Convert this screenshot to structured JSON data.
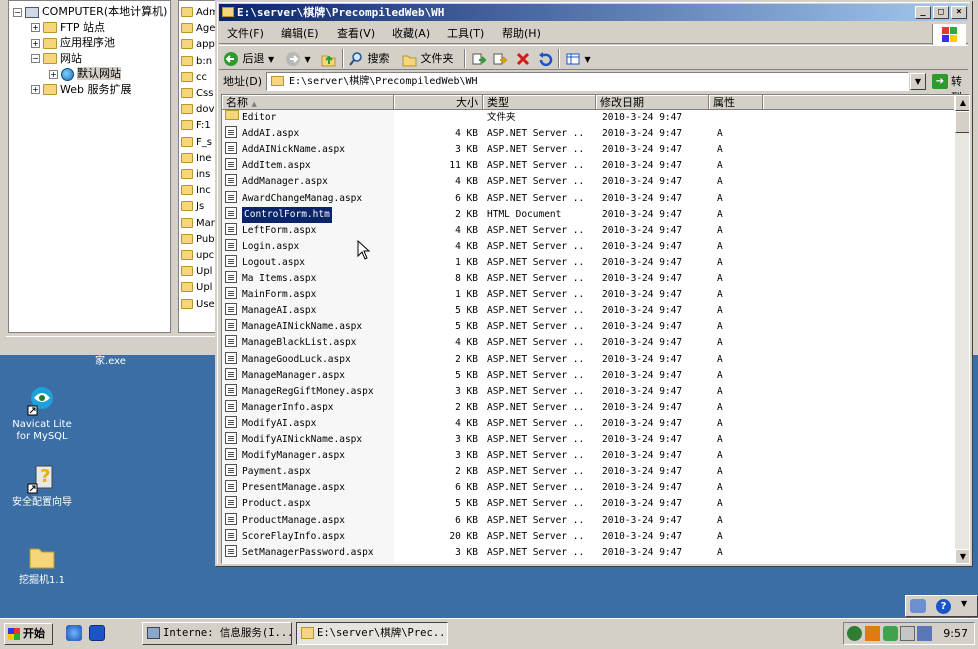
{
  "iis_tree": [
    {
      "label": "COMPUTER(本地计算机)",
      "icon": "computer-icon",
      "expander": "−"
    },
    {
      "label": "FTP 站点",
      "icon": "folder-icon",
      "expander": "+"
    },
    {
      "label": "应用程序池",
      "icon": "folder-icon",
      "expander": "+"
    },
    {
      "label": "网站",
      "icon": "folder-icon",
      "expander": "−"
    },
    {
      "label": "默认网站",
      "icon": "globe-icon",
      "expander": "+"
    },
    {
      "label": "Web 服务扩展",
      "icon": "folder-icon",
      "expander": "+"
    }
  ],
  "iis_list": [
    "Adm",
    "Age",
    "app",
    "b:n",
    "cc",
    "Css",
    "dov",
    "F:1",
    "F_s",
    "Ine",
    "ins",
    "Inc",
    "Js",
    "Mar",
    "Pub",
    "upc",
    "Upl",
    "Upl",
    "Use"
  ],
  "desktop": {
    "caption_top": "家.exe",
    "icons": [
      {
        "label1": "Navicat Lite",
        "label2": "for MySQL",
        "icon": "navicat-icon"
      },
      {
        "label1": "安全配置向导",
        "label2": "",
        "icon": "security-wizard-icon"
      },
      {
        "label1": "挖掘机1.1",
        "label2": "",
        "icon": "folder-icon"
      }
    ]
  },
  "window": {
    "title": "E:\\server\\棋牌\\PrecompiledWeb\\WH",
    "controls": {
      "minimize": "_",
      "maximize": "□",
      "close": "×"
    },
    "menu": [
      "文件(F)",
      "编辑(E)",
      "查看(V)",
      "收藏(A)",
      "工具(T)",
      "帮助(H)"
    ],
    "toolbar": {
      "back": "后退",
      "search": "搜索",
      "folders": "文件夹"
    },
    "address": {
      "label": "地址(D)",
      "value": "E:\\server\\棋牌\\PrecompiledWeb\\WH",
      "go": "转到"
    },
    "columns": {
      "name": "名称",
      "size": "大小",
      "type": "类型",
      "date": "修改日期",
      "attr": "属性"
    },
    "files": [
      {
        "name": "Editor",
        "size": "",
        "type": "文件夹",
        "date": "2010-3-24 9:47",
        "attr": "",
        "kind": "folder"
      },
      {
        "name": "AddAI.aspx",
        "size": "4 KB",
        "type": "ASP.NET Server ..",
        "date": "2010-3-24 9:47",
        "attr": "A",
        "kind": "file"
      },
      {
        "name": "AddAINickName.aspx",
        "size": "3 KB",
        "type": "ASP.NET Server ..",
        "date": "2010-3-24 9:47",
        "attr": "A",
        "kind": "file"
      },
      {
        "name": "AddItem.aspx",
        "size": "11 KB",
        "type": "ASP.NET Server ..",
        "date": "2010-3-24 9:47",
        "attr": "A",
        "kind": "file"
      },
      {
        "name": "AddManager.aspx",
        "size": "4 KB",
        "type": "ASP.NET Server ..",
        "date": "2010-3-24 9:47",
        "attr": "A",
        "kind": "file"
      },
      {
        "name": "AwardChangeManag.aspx",
        "size": "6 KB",
        "type": "ASP.NET Server ..",
        "date": "2010-3-24 9:47",
        "attr": "A",
        "kind": "file"
      },
      {
        "name": "ControlForm.htm",
        "size": "2 KB",
        "type": "HTML Document",
        "date": "2010-3-24 9:47",
        "attr": "A",
        "kind": "html",
        "selected": true
      },
      {
        "name": "LeftForm.aspx",
        "size": "4 KB",
        "type": "ASP.NET Server ..",
        "date": "2010-3-24 9:47",
        "attr": "A",
        "kind": "file"
      },
      {
        "name": "Login.aspx",
        "size": "4 KB",
        "type": "ASP.NET Server ..",
        "date": "2010-3-24 9:47",
        "attr": "A",
        "kind": "file"
      },
      {
        "name": "Logout.aspx",
        "size": "1 KB",
        "type": "ASP.NET Server ..",
        "date": "2010-3-24 9:47",
        "attr": "A",
        "kind": "file"
      },
      {
        "name": "Ma Items.aspx",
        "size": "8 KB",
        "type": "ASP.NET Server ..",
        "date": "2010-3-24 9:47",
        "attr": "A",
        "kind": "file"
      },
      {
        "name": "MainForm.aspx",
        "size": "1 KB",
        "type": "ASP.NET Server ..",
        "date": "2010-3-24 9:47",
        "attr": "A",
        "kind": "file"
      },
      {
        "name": "ManageAI.aspx",
        "size": "5 KB",
        "type": "ASP.NET Server ..",
        "date": "2010-3-24 9:47",
        "attr": "A",
        "kind": "file"
      },
      {
        "name": "ManageAINickName.aspx",
        "size": "5 KB",
        "type": "ASP.NET Server ..",
        "date": "2010-3-24 9:47",
        "attr": "A",
        "kind": "file"
      },
      {
        "name": "ManageBlackList.aspx",
        "size": "4 KB",
        "type": "ASP.NET Server ..",
        "date": "2010-3-24 9:47",
        "attr": "A",
        "kind": "file"
      },
      {
        "name": "ManageGoodLuck.aspx",
        "size": "2 KB",
        "type": "ASP.NET Server ..",
        "date": "2010-3-24 9:47",
        "attr": "A",
        "kind": "file"
      },
      {
        "name": "ManageManager.aspx",
        "size": "5 KB",
        "type": "ASP.NET Server ..",
        "date": "2010-3-24 9:47",
        "attr": "A",
        "kind": "file"
      },
      {
        "name": "ManageRegGiftMoney.aspx",
        "size": "3 KB",
        "type": "ASP.NET Server ..",
        "date": "2010-3-24 9:47",
        "attr": "A",
        "kind": "file"
      },
      {
        "name": "ManagerInfo.aspx",
        "size": "2 KB",
        "type": "ASP.NET Server ..",
        "date": "2010-3-24 9:47",
        "attr": "A",
        "kind": "file"
      },
      {
        "name": "ModifyAI.aspx",
        "size": "4 KB",
        "type": "ASP.NET Server ..",
        "date": "2010-3-24 9:47",
        "attr": "A",
        "kind": "file"
      },
      {
        "name": "ModifyAINickName.aspx",
        "size": "3 KB",
        "type": "ASP.NET Server ..",
        "date": "2010-3-24 9:47",
        "attr": "A",
        "kind": "file"
      },
      {
        "name": "ModifyManager.aspx",
        "size": "3 KB",
        "type": "ASP.NET Server ..",
        "date": "2010-3-24 9:47",
        "attr": "A",
        "kind": "file"
      },
      {
        "name": "Payment.aspx",
        "size": "2 KB",
        "type": "ASP.NET Server ..",
        "date": "2010-3-24 9:47",
        "attr": "A",
        "kind": "file"
      },
      {
        "name": "PresentManage.aspx",
        "size": "6 KB",
        "type": "ASP.NET Server ..",
        "date": "2010-3-24 9:47",
        "attr": "A",
        "kind": "file"
      },
      {
        "name": "Product.aspx",
        "size": "5 KB",
        "type": "ASP.NET Server ..",
        "date": "2010-3-24 9:47",
        "attr": "A",
        "kind": "file"
      },
      {
        "name": "ProductManage.aspx",
        "size": "6 KB",
        "type": "ASP.NET Server ..",
        "date": "2010-3-24 9:47",
        "attr": "A",
        "kind": "file"
      },
      {
        "name": "ScoreFlayInfo.aspx",
        "size": "20 KB",
        "type": "ASP.NET Server ..",
        "date": "2010-3-24 9:47",
        "attr": "A",
        "kind": "file"
      },
      {
        "name": "SetManagerPassword.aspx",
        "size": "3 KB",
        "type": "ASP.NET Server ..",
        "date": "2010-3-24 9:47",
        "attr": "A",
        "kind": "file"
      }
    ]
  },
  "taskbar": {
    "start": "开始",
    "tasks": [
      {
        "label": "Interne: 信息服务(I...",
        "icon": "iis-icon",
        "active": false
      },
      {
        "label": "E:\\server\\棋牌\\Prec...",
        "icon": "folder-icon",
        "active": true
      }
    ],
    "clock": "9:57"
  },
  "colors": {
    "desktop": "#3a6ea5",
    "titlebar": "#0a246a",
    "selection": "#0a246a"
  }
}
